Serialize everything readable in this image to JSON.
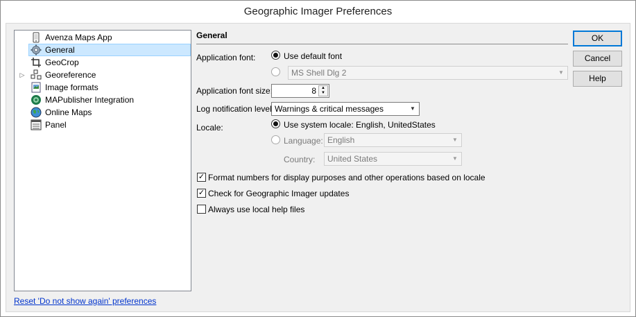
{
  "window": {
    "title": "Geographic Imager Preferences"
  },
  "tree": {
    "items": [
      {
        "label": "Avenza Maps App",
        "icon": "phone-icon"
      },
      {
        "label": "General",
        "icon": "gear-icon",
        "selected": true
      },
      {
        "label": "GeoCrop",
        "icon": "crop-icon"
      },
      {
        "label": "Georeference",
        "icon": "georeference-icon",
        "expandable": true
      },
      {
        "label": "Image formats",
        "icon": "image-formats-icon"
      },
      {
        "label": "MAPublisher Integration",
        "icon": "mapublisher-icon"
      },
      {
        "label": "Online Maps",
        "icon": "globe-icon"
      },
      {
        "label": "Panel",
        "icon": "panel-icon"
      }
    ]
  },
  "reset_link": "Reset 'Do not show again' preferences",
  "general": {
    "title": "General",
    "app_font_label": "Application font:",
    "use_default_font": "Use default font",
    "custom_font_value": "MS Shell Dlg 2",
    "font_size_label": "Application font size:",
    "font_size_value": "8",
    "log_level_label": "Log notification level:",
    "log_level_value": "Warnings & critical messages",
    "locale_label": "Locale:",
    "use_system_locale": "Use system locale: English, UnitedStates",
    "language_label": "Language:",
    "language_value": "English",
    "country_label": "Country:",
    "country_value": "United States",
    "opt_format_numbers": "Format numbers for display purposes and other operations based on locale",
    "opt_check_updates": "Check for Geographic Imager updates",
    "opt_local_help": "Always use local help files"
  },
  "buttons": {
    "ok": "OK",
    "cancel": "Cancel",
    "help": "Help"
  },
  "colors": {
    "selection": "#cce8ff",
    "link": "#0033cc",
    "accent": "#0078d7"
  }
}
